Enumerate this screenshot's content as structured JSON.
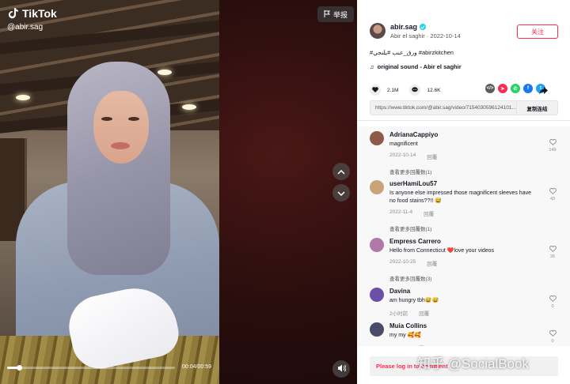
{
  "video": {
    "brand": "TikTok",
    "handle": "@abir.sag",
    "report_label": "举报",
    "time": "00:04/00:59",
    "progress": 0.07
  },
  "author": {
    "name": "abir.sag",
    "subline": "Abir el saghir · 2022-10-14",
    "follow_label": "关注"
  },
  "post": {
    "description": "#ورق_عنب #يلنجي #abirzkitchen",
    "sound": "original sound - Abir el saghir",
    "likes": "2.1M",
    "comments": "12.6K",
    "url": "https://www.tiktok.com/@abir.sag/video/7154030596124101...",
    "copy_label": "复制连结"
  },
  "share_icons": [
    {
      "name": "embed-icon",
      "color": "#5c5c5c",
      "glyph": "</>"
    },
    {
      "name": "send-icon",
      "color": "#fe2c55",
      "glyph": "➤"
    },
    {
      "name": "whatsapp-icon",
      "color": "#25d366",
      "glyph": "✆"
    },
    {
      "name": "facebook-icon",
      "color": "#1877f2",
      "glyph": "f"
    },
    {
      "name": "twitter-icon",
      "color": "#1da1f2",
      "glyph": "t"
    }
  ],
  "comments": [
    {
      "name": "AdrianaCappiyo",
      "text": "magnificent",
      "date": "2022-10-14",
      "reply": "回覆",
      "likes": "149",
      "more": "查看更多回覆数(1)",
      "avatar": "#8d5a4a"
    },
    {
      "name": "userHamiLou57",
      "text": "Is anyone else impressed those magnificent sleeves have no food stains??!! 😅",
      "date": "2022-11-4",
      "reply": "回覆",
      "likes": "43",
      "more": "查看更多回覆数(1)",
      "avatar": "#c9a37a"
    },
    {
      "name": "Empress Carrero",
      "text": "Hello from Connecticut ❤️love your videos",
      "date": "2022-10-25",
      "reply": "回覆",
      "likes": "26",
      "more": "查看更多回覆数(3)",
      "avatar": "#b07aa8"
    },
    {
      "name": "Davina",
      "text": "am hungry tbh😅😅",
      "date": "2小时前",
      "reply": "回覆",
      "likes": "0",
      "more": "",
      "avatar": "#6b4fa8"
    },
    {
      "name": "Muia Collins",
      "text": "my my 🥰🥰",
      "date": "1天前",
      "reply": "回覆",
      "likes": "0",
      "more": "",
      "avatar": "#4a4a6a"
    }
  ],
  "login_prompt": "Please log in to comment",
  "watermark": "知乎 @SocialBook"
}
